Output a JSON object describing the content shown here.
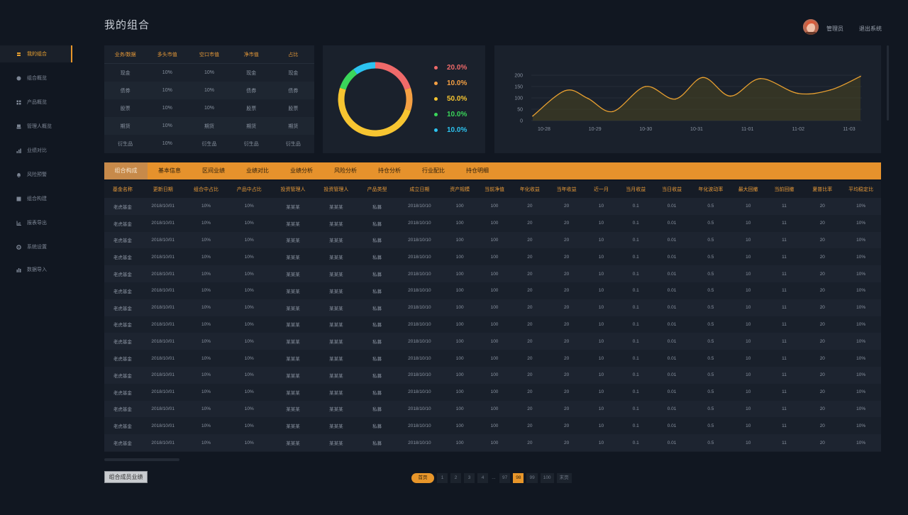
{
  "page_title": "我的组合",
  "user": {
    "name": "管理员",
    "logout": "退出系统"
  },
  "sidebar": {
    "items": [
      {
        "label": "我的组合",
        "icon": "portfolio-icon",
        "active": true
      },
      {
        "label": "组合概览",
        "icon": "pie-icon"
      },
      {
        "label": "产品概览",
        "icon": "grid-icon"
      },
      {
        "label": "管理人概览",
        "icon": "person-icon"
      },
      {
        "label": "业绩对比",
        "icon": "compare-icon"
      },
      {
        "label": "风险预警",
        "icon": "bell-icon"
      },
      {
        "label": "组合构建",
        "icon": "build-icon"
      },
      {
        "label": "报表导出",
        "icon": "chart-icon"
      },
      {
        "label": "系统设置",
        "icon": "gear-icon"
      },
      {
        "label": "数据导入",
        "icon": "import-icon"
      }
    ]
  },
  "summary_table": {
    "headers": [
      "业务/数据",
      "多头市值",
      "空口市值",
      "净市值",
      "占比"
    ],
    "rows": [
      [
        "现金",
        "10%",
        "10%",
        "现金",
        "现金"
      ],
      [
        "债券",
        "10%",
        "10%",
        "债券",
        "债券"
      ],
      [
        "股票",
        "10%",
        "10%",
        "股票",
        "股票"
      ],
      [
        "期货",
        "10%",
        "期货",
        "期货",
        "期货"
      ],
      [
        "衍生品",
        "10%",
        "衍生品",
        "衍生品",
        "衍生品"
      ]
    ]
  },
  "donut": {
    "segments": [
      {
        "label": "20.0%",
        "value": 20,
        "color": "#ef6a6a"
      },
      {
        "label": "10.0%",
        "value": 10,
        "color": "#f5a043"
      },
      {
        "label": "50.0%",
        "value": 50,
        "color": "#f7c531"
      },
      {
        "label": "10.0%",
        "value": 10,
        "color": "#3ad65a"
      },
      {
        "label": "10.0%",
        "value": 10,
        "color": "#2cc3f0"
      }
    ]
  },
  "chart_data": {
    "type": "area",
    "x": [
      "10-28",
      "10-29",
      "10-30",
      "10-31",
      "11-01",
      "11-02",
      "11-03"
    ],
    "y": [
      20,
      132,
      98,
      40,
      150,
      95,
      190,
      108,
      185,
      120,
      135,
      195
    ],
    "x_points": [
      0,
      0.65,
      1.1,
      1.6,
      2.25,
      2.85,
      3.4,
      3.95,
      4.55,
      5.3,
      5.95,
      6.55
    ],
    "yticks": [
      0,
      50,
      100,
      150,
      200
    ],
    "ylim": [
      0,
      200
    ],
    "line_color": "#e8a030",
    "fill_color": "#4a4520"
  },
  "tabs": [
    "组合构成",
    "基本信息",
    "区间业绩",
    "业绩对比",
    "业绩分析",
    "风险分析",
    "持仓分析",
    "行业配比",
    "持仓明细"
  ],
  "main_table": {
    "headers": [
      "基金名称",
      "更新日期",
      "组合中占比",
      "产品中占比",
      "投资管理人",
      "投资管理人",
      "产品类型",
      "成立日期",
      "资产规模",
      "当前净值",
      "年化收益",
      "当年收益",
      "近一月",
      "当月收益",
      "当日收益",
      "年化波动率",
      "最大回撤",
      "当前回撤",
      "夏普比率",
      "平均稳定比"
    ],
    "row": [
      "老虎基金",
      "2018/10/01",
      "10%",
      "10%",
      "某某某",
      "某某某",
      "私募",
      "2018/10/10",
      "100",
      "100",
      "20",
      "20",
      "10",
      "0.1",
      "0.01",
      "0.5",
      "10",
      "11",
      "20",
      "10%"
    ],
    "row_count": 15
  },
  "bottom_button": "组合成员业绩",
  "pagination": {
    "first": "首页",
    "pages": [
      "1",
      "2",
      "3",
      "4",
      "...",
      "97",
      "98",
      "99",
      "100"
    ],
    "current": "98",
    "last": "末页"
  }
}
